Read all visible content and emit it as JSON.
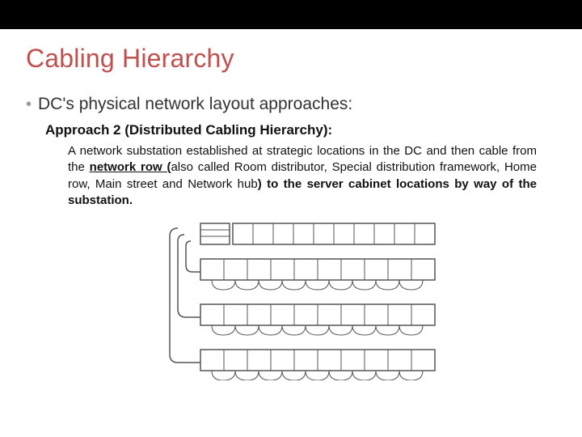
{
  "title": "Cabling Hierarchy",
  "bullet": "DC's physical network layout approaches:",
  "approach_title": "Approach 2 (Distributed Cabling Hierarchy):",
  "body": {
    "p1a": "A network substation established at strategic locations in the DC and then cable from the ",
    "p1b": "network row (",
    "p1c": "also called Room distributor, Special distribution framework, Home row, Main street and Network hub",
    "p1d": ") to the server cabinet locations by way of the substation."
  }
}
